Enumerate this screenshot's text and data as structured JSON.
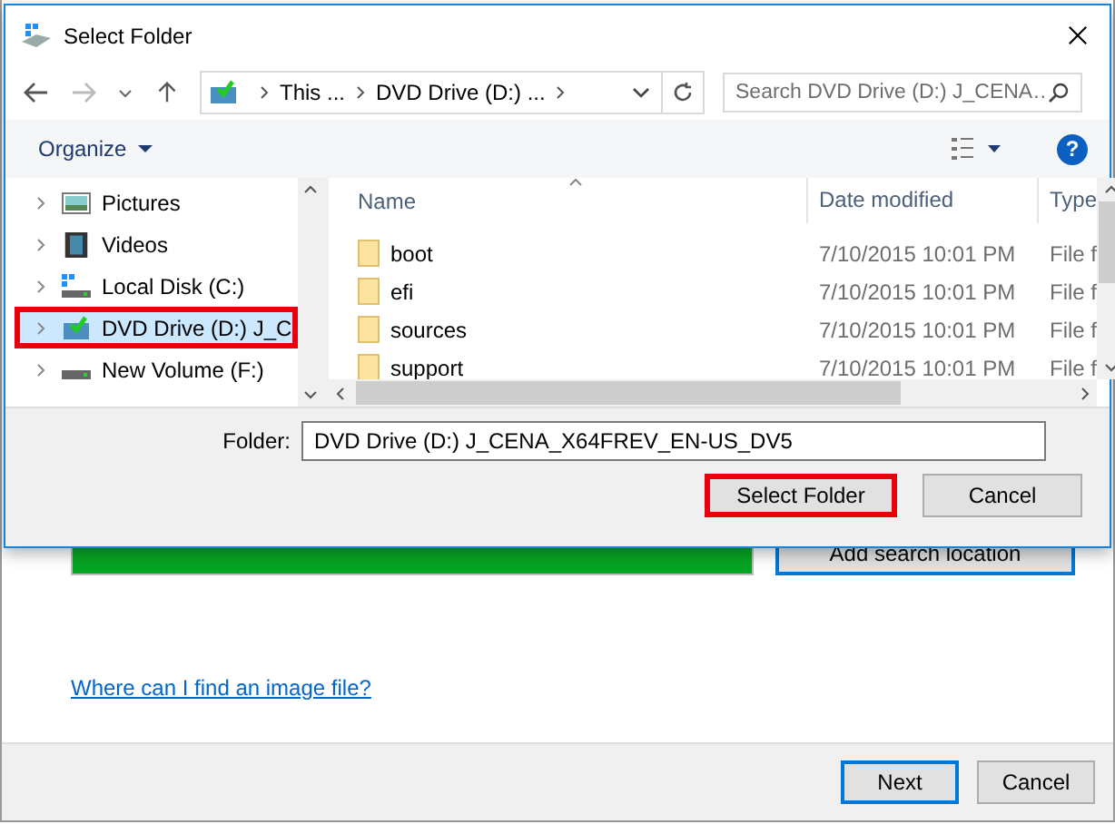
{
  "background_window": {
    "progress": {
      "level": 1
    },
    "add_button": "Add search location",
    "link": "Where can I find an image file?",
    "buttons": [
      {
        "label": "Next",
        "default": true
      },
      {
        "label": "Cancel",
        "default": false
      }
    ]
  },
  "dialog": {
    "title": "Select Folder",
    "breadcrumbs": [
      "This ...",
      "DVD Drive (D:) ..."
    ],
    "search": {
      "placeholder": "Search DVD Drive (D:) J_CENA…"
    },
    "organize": "Organize",
    "help": "?",
    "nav_items": [
      {
        "label": "Pictures",
        "kind": "pictures",
        "selected": false,
        "highlighted": false
      },
      {
        "label": "Videos",
        "kind": "videos",
        "selected": false,
        "highlighted": false
      },
      {
        "label": "Local Disk (C:)",
        "kind": "system-disk",
        "selected": false,
        "highlighted": false
      },
      {
        "label": "DVD Drive (D:) J_C",
        "kind": "dvd",
        "selected": true,
        "highlighted": true
      },
      {
        "label": "New Volume (F:)",
        "kind": "disk",
        "selected": false,
        "highlighted": false
      }
    ],
    "columns": [
      "Name",
      "Date modified",
      "Type"
    ],
    "rows": [
      {
        "name": "boot",
        "date": "7/10/2015 10:01 PM",
        "type": "File f"
      },
      {
        "name": "efi",
        "date": "7/10/2015 10:01 PM",
        "type": "File f"
      },
      {
        "name": "sources",
        "date": "7/10/2015 10:01 PM",
        "type": "File f"
      },
      {
        "name": "support",
        "date": "7/10/2015 10:01 PM",
        "type": "File f"
      }
    ],
    "folder_label": "Folder:",
    "folder_value": "DVD Drive (D:) J_CENA_X64FREV_EN-US_DV5",
    "buttons": [
      {
        "label": "Select Folder",
        "highlighted": true
      },
      {
        "label": "Cancel",
        "highlighted": false
      }
    ]
  }
}
